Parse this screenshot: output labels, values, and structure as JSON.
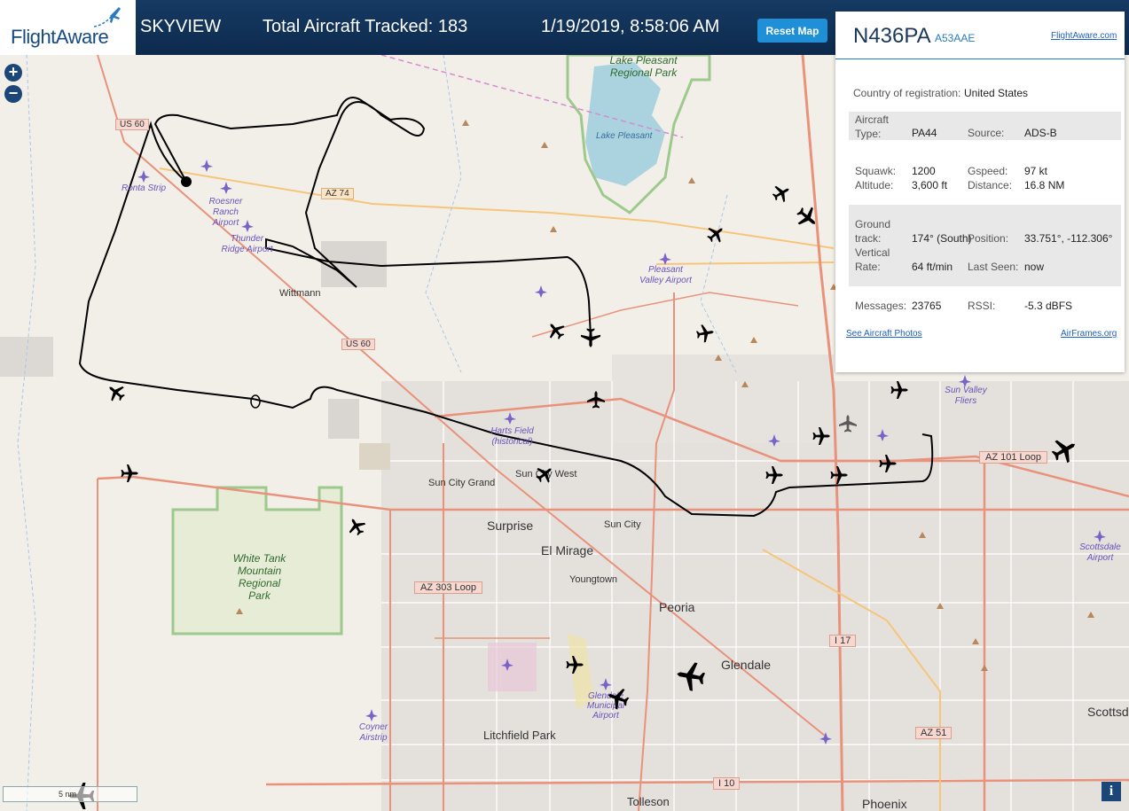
{
  "header": {
    "logo": "FlightAware",
    "app_name": "SKYVIEW",
    "aircraft_tracked": "Total Aircraft Tracked: 183",
    "datetime": "1/19/2019, 8:58:06 AM",
    "reset_label": "Reset Map"
  },
  "zoom": {
    "in": "+",
    "out": "−"
  },
  "panel": {
    "callsign": "N436PA",
    "hex": "A53AAE",
    "fa_link": "FlightAware.com",
    "country_label": "Country of registration:",
    "country_value": "United States",
    "type_label": "Aircraft Type:",
    "type_value": "PA44",
    "source_label": "Source:",
    "source_value": "ADS-B",
    "squawk_label": "Squawk:",
    "squawk_value": "1200",
    "altitude_label": "Altitude:",
    "altitude_value": "3,600 ft",
    "gspeed_label": "Gspeed:",
    "gspeed_value": "97 kt",
    "distance_label": "Distance:",
    "distance_value": "16.8 NM",
    "track_label": "Ground track:",
    "track_value": "174° (South)",
    "position_label": "Position:",
    "position_value": "33.751°, -112.306°",
    "vrate_label": "Vertical Rate:",
    "vrate_value": "64 ft/min",
    "lastseen_label": "Last Seen:",
    "lastseen_value": "now",
    "messages_label": "Messages:",
    "messages_value": "23765",
    "rssi_label": "RSSI:",
    "rssi_value": "-5.3 dBFS",
    "photos_link": "See Aircraft Photos",
    "airframes_link": "AirFrames.org"
  },
  "map_labels": {
    "lake_pleasant_park": "Lake Pleasant Regional Park",
    "lake_pleasant": "Lake Pleasant",
    "ronta": "Ronta Strip",
    "roesner": "Roesner Ranch Airport",
    "thunder": "Thunder Ridge Airport",
    "wittmann": "Wittmann",
    "us60a": "US 60",
    "us60b": "US 60",
    "az74": "AZ 74",
    "pleasant_valley": "Pleasant Valley Airport",
    "harts": "Harts Field (historical)",
    "sun_city_grand": "Sun City Grand",
    "sun_city_west": "Sun City West",
    "surprise": "Surprise",
    "sun_city": "Sun City",
    "el_mirage": "El Mirage",
    "youngtown": "Youngtown",
    "peoria": "Peoria",
    "glendale": "Glendale",
    "glendale_airport": "Glendale Municipal Airport",
    "white_tank": "White Tank Mountain Regional Park",
    "az303": "AZ 303 Loop",
    "az101": "AZ 101 Loop",
    "i17": "I 17",
    "i10": "I 10",
    "az51": "AZ 51",
    "litchfield": "Litchfield Park",
    "coyner": "Coyner Airstrip",
    "tolleson": "Tolleson",
    "phoenix": "Phoenix",
    "scottsdale": "Scottsd",
    "scottsdale_airport": "Scottsdale Airport",
    "sun_valley": "Sun Valley Fliers"
  },
  "scale_label": "5 nm",
  "info": "i"
}
